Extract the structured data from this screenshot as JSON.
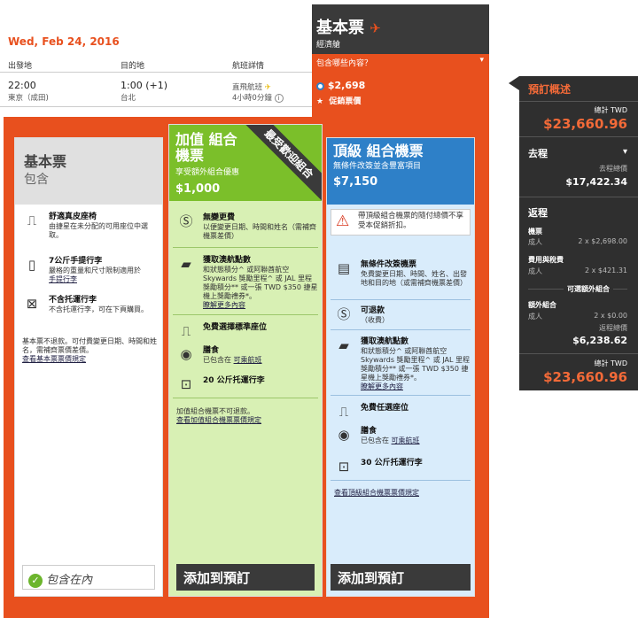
{
  "flight": {
    "date": "Wed, Feb 24, 2016",
    "col_from": "出發地",
    "col_to": "目的地",
    "col_details": "航班詳情",
    "dep_time": "22:00",
    "dep_place": "東京（成田)",
    "arr_time": "1:00 (+1)",
    "arr_place": "台北",
    "type": "直飛航班",
    "duration": "4小時0分鐘"
  },
  "fare_tab": {
    "title": "基本票",
    "subtitle": "經濟艙",
    "included": "包含哪些內容？",
    "price": "$2,698",
    "promo": "促銷票價"
  },
  "cards": [
    {
      "title": "基本票",
      "subtitle": "包含",
      "features": [
        {
          "icon": "seat-icon",
          "title": "舒適真皮座椅",
          "desc": "由捷星在未分配的可用座位中選取。"
        },
        {
          "icon": "carry-on-bag-icon",
          "title": "7公斤手提行李",
          "desc": "嚴格的重量和尺寸限制適用於",
          "link": "手提行李"
        },
        {
          "icon": "no-checked-bag-icon",
          "title": "不含托運行李",
          "desc": "不含托運行李，可在下頁購買。"
        }
      ],
      "note": "基本票不退款。可付費變更日期、時間和姓名，需補齊票價差價。",
      "note_link": "查看基本票票價規定",
      "included": "包含在內"
    },
    {
      "title": "加值 組合機票",
      "subtitle": "享受額外組合優惠",
      "price": "$1,000",
      "ribbon": "最受歡迎組合",
      "features": [
        {
          "icon": "free-change-icon",
          "title": "無變更費",
          "desc": "以便變更日期、時間和姓名（需補齊機票差價）"
        },
        {
          "icon": "points-card-icon",
          "title": "獲取澳航點數",
          "desc": "和狀態積分^ 或阿聯酋航空 Skywards 獎勵里程^ 或 JAL 里程獎勵積分** 或一張 TWD $350 捷星機上獎勵禮券*。",
          "link": "瞭解更多內容"
        },
        {
          "icon": "standard-seat-icon",
          "title": "免費選擇標準座位"
        },
        {
          "icon": "meal-icon",
          "title": "膳食",
          "desc": "已包含在",
          "link": "可乘航班"
        },
        {
          "icon": "checked-bag-icon",
          "title": "20 公斤托運行李"
        }
      ],
      "note": "加值組合機票不可退款。",
      "note_link": "查看加值組合機票票價規定",
      "button": "添加到預訂"
    },
    {
      "title": "頂級 組合機票",
      "subtitle": "無條件改簽並含豐富項目",
      "price": "$7,150",
      "warning": "帶頂級組合機票的隨付總價不享受本促銷折扣。",
      "features": [
        {
          "icon": "ticket-change-icon",
          "title": "無條件改簽機票",
          "desc": "免費變更日期、時間、姓名、出發地和目的地（或需補齊機票差價）"
        },
        {
          "icon": "refund-icon",
          "title": "可退款",
          "desc": "（收費）"
        },
        {
          "icon": "points-card-icon",
          "title": "獲取澳航點數",
          "desc": "和狀態積分^ 或阿聯酋航空 Skywards 獎勵里程^ 或 JAL 里程獎勵積分** 或一張 TWD $350 捷星機上獎勵禮券*。",
          "link": "瞭解更多內容"
        },
        {
          "icon": "any-seat-icon",
          "title": "免費任選座位"
        },
        {
          "icon": "meal-icon",
          "title": "膳食",
          "desc": "已包含在",
          "link": "可乘航班"
        },
        {
          "icon": "checked-bag-icon",
          "title": "30 公斤托運行李"
        }
      ],
      "note_link": "查看頂級組合機票票價規定",
      "button": "添加到預訂"
    }
  ],
  "summary": {
    "title": "預訂概述",
    "total_label": "總計 TWD",
    "total": "$23,660.96",
    "outbound": "去程",
    "outbound_label": "去程總價",
    "outbound_total": "$17,422.34",
    "return": "返程",
    "fare": "機票",
    "adult": "成人",
    "fare_amt": "2 x $2,698.00",
    "fees": "費用與稅費",
    "fees_amt": "2 x $421.31",
    "optional": "可選額外組合",
    "extra": "額外組合",
    "extra_amt": "2 x $0.00",
    "return_label": "返程總價",
    "return_total": "$6,238.62",
    "total_label2": "總計 TWD",
    "total2": "$23,660.96"
  },
  "colors": {
    "accent": "#e8501e",
    "dark": "#3a3a3a",
    "green": "#7bbf2a",
    "blue": "#2e80c8"
  }
}
